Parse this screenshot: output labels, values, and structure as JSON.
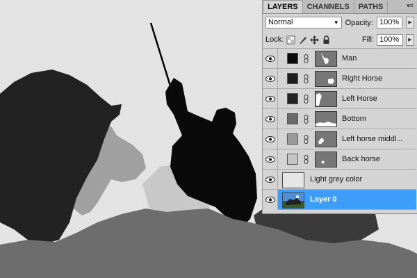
{
  "panel": {
    "tabs": [
      {
        "label": "LAYERS",
        "active": true
      },
      {
        "label": "CHANNELS",
        "active": false
      },
      {
        "label": "PATHS",
        "active": false
      }
    ],
    "blend_mode": "Normal",
    "opacity_label": "Opacity:",
    "opacity_value": "100%",
    "lock_label": "Lock:",
    "fill_label": "Fill:",
    "fill_value": "100%"
  },
  "layers": [
    {
      "name": "Man",
      "swatch": "#0a0a0a",
      "has_mask": true
    },
    {
      "name": "Right Horse",
      "swatch": "#1e1e1e",
      "has_mask": true
    },
    {
      "name": "Left Horse",
      "swatch": "#222222",
      "has_mask": true
    },
    {
      "name": "Bottom",
      "swatch": "#6a6a6a",
      "has_mask": true
    },
    {
      "name": "Left horse middl...",
      "swatch": "#9a9a9a",
      "has_mask": true
    },
    {
      "name": "Back horse",
      "swatch": "#c6c6c6",
      "has_mask": true
    },
    {
      "name": "Light grey color",
      "swatch": "#e3e3e3",
      "has_mask": false
    },
    {
      "name": "Layer 0",
      "selected": true,
      "has_mask": false
    }
  ],
  "colors": {
    "accent": "#3d9ef9",
    "canvas_bg": "#e3e3e3"
  }
}
